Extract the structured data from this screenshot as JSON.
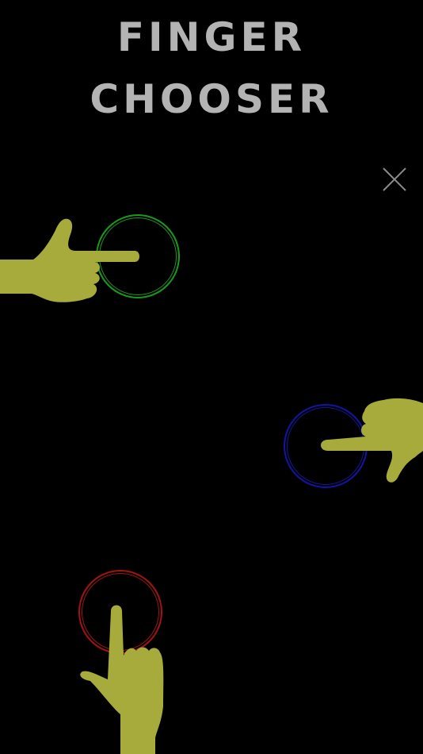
{
  "app": {
    "title_line1": "FINGER",
    "title_line2": "CHOOSER"
  },
  "colors": {
    "background": "#000000",
    "title": "#b3b3b3",
    "hand": "#a6ab3c",
    "close": "#8c8c8c",
    "ring_green": "#1a9a1a",
    "ring_blue": "#1414a0",
    "ring_red": "#a01414"
  },
  "icons": {
    "close": "close-icon",
    "hand": "pointing-hand-icon"
  },
  "touches": [
    {
      "name": "touch-green",
      "color": "green"
    },
    {
      "name": "touch-blue",
      "color": "blue"
    },
    {
      "name": "touch-red",
      "color": "red"
    }
  ]
}
